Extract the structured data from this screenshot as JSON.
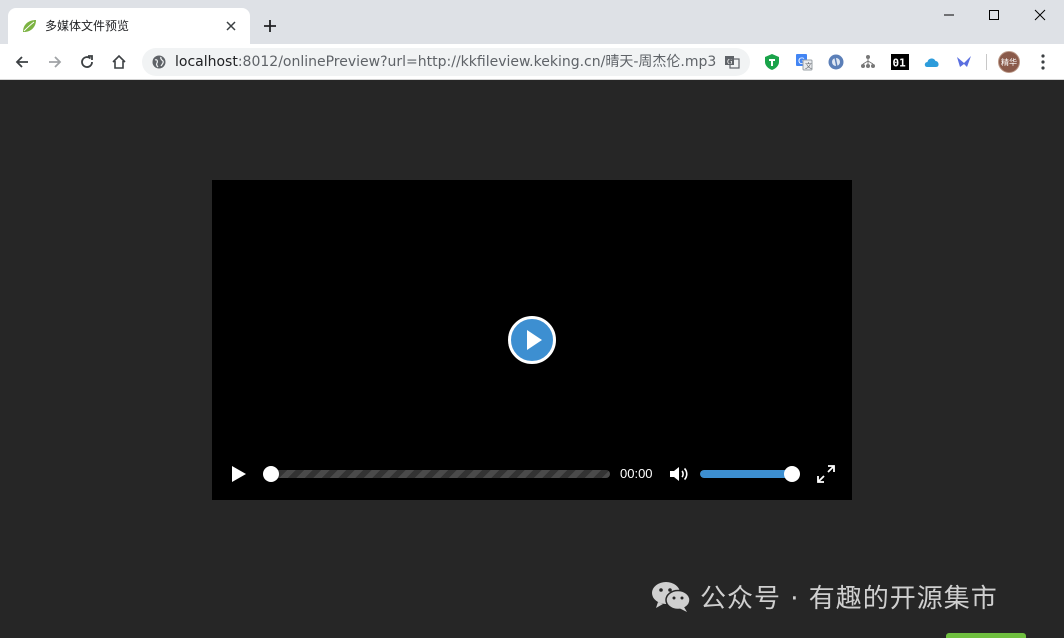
{
  "tab": {
    "title": "多媒体文件预览",
    "favicon": "spring-leaf-icon"
  },
  "window_controls": [
    "minimize",
    "maximize",
    "close"
  ],
  "address": {
    "host": "localhost",
    "rest": ":8012/onlinePreview?url=http://kkfileview.keking.cn/晴天-周杰伦.mp3"
  },
  "extensions": [
    "shield-icon",
    "google-translate-icon",
    "o-icon",
    "tree-icon",
    "binary-01-icon",
    "cloud-icon",
    "bird-icon"
  ],
  "profile": {
    "label": "精华"
  },
  "player": {
    "time": "00:00",
    "progress": 0,
    "volume": 1.0,
    "accent_color": "#3d8fd1"
  },
  "watermark": {
    "text": "公众号 · 有趣的开源集市"
  }
}
